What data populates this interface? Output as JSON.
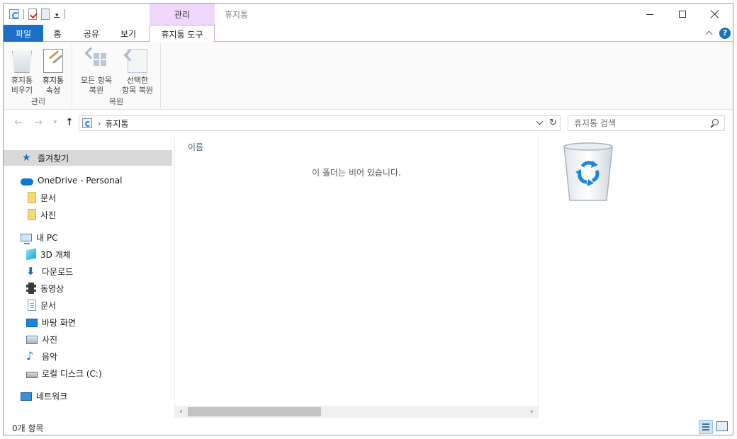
{
  "titlebar": {
    "contextual_tab": "관리",
    "title": "휴지통"
  },
  "ribbon": {
    "tabs": {
      "file": "파일",
      "home": "홈",
      "share": "공유",
      "view": "보기",
      "tools": "휴지통 도구"
    },
    "groups": {
      "manage": {
        "label": "관리",
        "empty_line1": "휴지통",
        "empty_line2": "비우기",
        "props_line1": "휴지통",
        "props_line2": "속성"
      },
      "restore": {
        "label": "복원",
        "all_line1": "모든 항목",
        "all_line2": "복원",
        "sel_line1": "선택한",
        "sel_line2": "항목 복원"
      }
    }
  },
  "address": {
    "location": "휴지통",
    "search_placeholder": "휴지통 검색"
  },
  "navpane": {
    "quick_access": "즐겨찾기",
    "onedrive": "OneDrive - Personal",
    "od_documents": "문서",
    "od_pictures": "사진",
    "this_pc": "내 PC",
    "objects3d": "3D 개체",
    "downloads": "다운로드",
    "videos": "동영상",
    "documents": "문서",
    "desktop": "바탕 화면",
    "pictures": "사진",
    "music": "음악",
    "local_disk": "로컬 디스크 (C:)",
    "network": "네트워크"
  },
  "content": {
    "column_name": "이름",
    "empty_message": "이 폴더는 비어 있습니다."
  },
  "status": {
    "item_count": "0개 항목"
  },
  "colors": {
    "accent": "#1b6fc4",
    "contextual": "#efd8fb",
    "selected": "#d9d9d9"
  }
}
